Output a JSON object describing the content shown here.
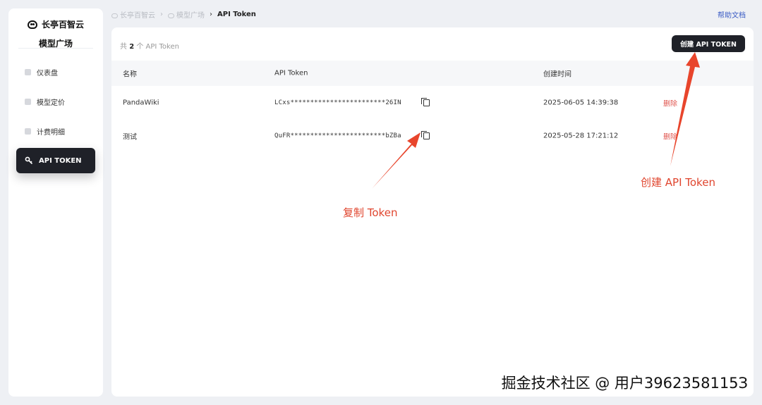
{
  "brand": {
    "name": "长亭百智云",
    "subtitle": "模型广场"
  },
  "nav": [
    {
      "label": "仪表盘",
      "icon": "dashboard-icon"
    },
    {
      "label": "模型定价",
      "icon": "cube-icon"
    },
    {
      "label": "计费明细",
      "icon": "receipt-icon"
    },
    {
      "label": "API TOKEN",
      "icon": "key-icon",
      "active": true
    }
  ],
  "breadcrumb": {
    "home": "长亭百智云",
    "section": "模型广场",
    "current": "API Token"
  },
  "help_link": "帮助文档",
  "panel": {
    "count_prefix": "共",
    "count": "2",
    "count_suffix": "个 API Token",
    "create_button": "创建 API TOKEN"
  },
  "table": {
    "columns": [
      "名称",
      "API Token",
      "创建时间",
      ""
    ],
    "rows": [
      {
        "name": "PandaWiki",
        "token": "LCxs************************26IN",
        "created": "2025-06-05 14:39:38",
        "action": "删除"
      },
      {
        "name": "测试",
        "token": "QuFR************************bZBa",
        "created": "2025-05-28 17:21:12",
        "action": "删除"
      }
    ]
  },
  "annotations": {
    "copy": "复制 Token",
    "create": "创建 API Token"
  },
  "watermark": "掘金技术社区 @ 用户3962358115З",
  "colors": {
    "accent_dark": "#1f2128",
    "danger": "#e0564f",
    "annotation": "#e0452e",
    "link": "#3b5cc4"
  }
}
